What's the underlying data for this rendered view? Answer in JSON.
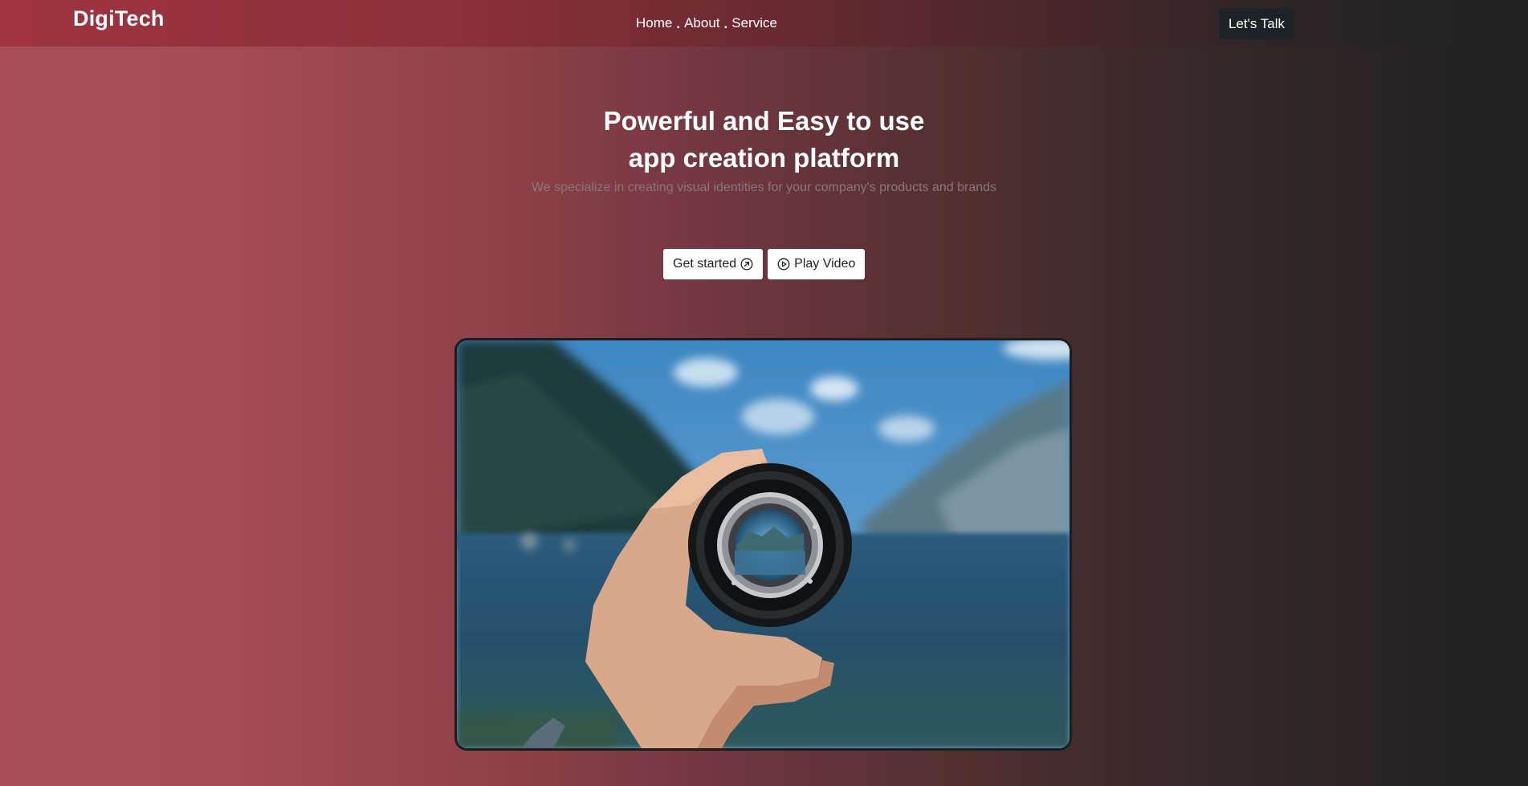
{
  "brand": {
    "name": "DigiTech"
  },
  "nav": {
    "items": [
      {
        "label": "Home"
      },
      {
        "label": "About"
      },
      {
        "label": "Service"
      }
    ],
    "separator": "."
  },
  "cta": {
    "label": "Let's Talk"
  },
  "hero": {
    "title_line1": "Powerful and Easy to use",
    "title_line2": "app creation platform",
    "subtitle": "We specialize in creating visual identities for your company's products and brands"
  },
  "buttons": {
    "get_started": {
      "label": "Get started",
      "icon": "arrow-up-right-circle-icon"
    },
    "play_video": {
      "label": "Play Video",
      "icon": "play-circle-icon"
    }
  },
  "hero_image": {
    "subject": "hand-holding-camera-lens-icon"
  },
  "colors": {
    "cta_bg": "#1e2327",
    "button_bg": "#ffffff",
    "accent": "#a94e57"
  }
}
